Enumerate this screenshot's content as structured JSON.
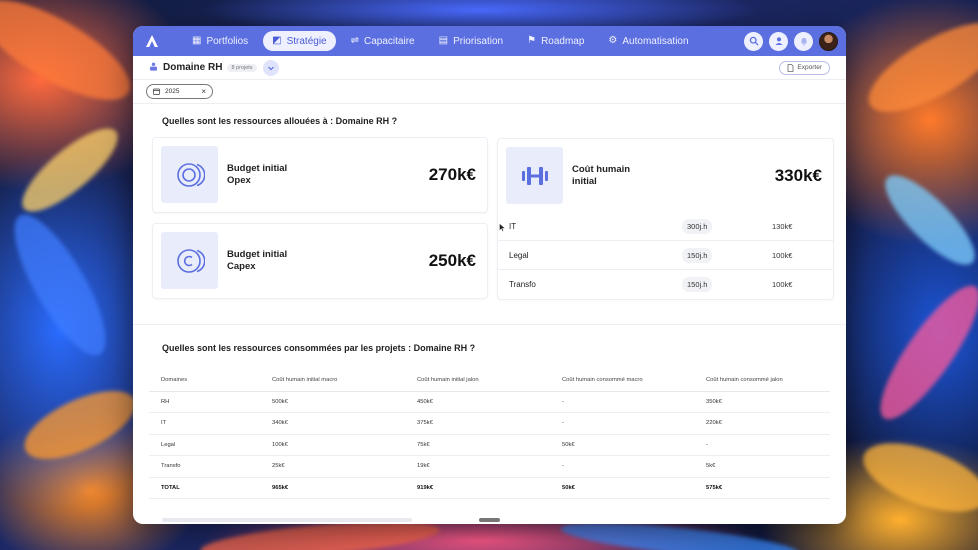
{
  "nav": {
    "items": [
      {
        "label": "Portfolios",
        "icon": "grid-icon",
        "glyph": "▦"
      },
      {
        "label": "Stratégie",
        "icon": "strategy-icon",
        "glyph": "◩"
      },
      {
        "label": "Capacitaire",
        "icon": "capacity-icon",
        "glyph": "⇌"
      },
      {
        "label": "Priorisation",
        "icon": "priority-icon",
        "glyph": "▤"
      },
      {
        "label": "Roadmap",
        "icon": "flag-icon",
        "glyph": "⚑"
      },
      {
        "label": "Automatisation",
        "icon": "robot-icon",
        "glyph": "⚙"
      }
    ],
    "active_index": 1,
    "accent": "#5b6fe0"
  },
  "subheader": {
    "title": "Domaine RH",
    "badge": "8 projets",
    "export_label": "Exporter"
  },
  "filter": {
    "year": "2025"
  },
  "section1": {
    "title": "Quelles sont les ressources allouées à : Domaine RH ?",
    "cards": [
      {
        "label_line1": "Budget initial",
        "label_line2": "Opex",
        "value": "270k€"
      },
      {
        "label_line1": "Budget initial",
        "label_line2": "Capex",
        "value": "250k€"
      },
      {
        "label_line1": "Coût humain",
        "label_line2": "initial",
        "value": "330k€"
      }
    ],
    "human_rows": [
      {
        "name": "IT",
        "effort": "300j.h",
        "cost": "130k€"
      },
      {
        "name": "Legal",
        "effort": "150j.h",
        "cost": "100k€"
      },
      {
        "name": "Transfo",
        "effort": "150j.h",
        "cost": "100k€"
      }
    ]
  },
  "section2": {
    "title": "Quelles sont les ressources consommées par les projets : Domaine RH ?",
    "headers": [
      "Domaines",
      "Coût humain initial macro",
      "Coût humain initial jalon",
      "Coût humain consommé macro",
      "Coût humain consommé jalon"
    ],
    "rows": [
      [
        "RH",
        "500k€",
        "450k€",
        "-",
        "350k€"
      ],
      [
        "IT",
        "340k€",
        "375k€",
        "-",
        "220k€"
      ],
      [
        "Legal",
        "100k€",
        "75k€",
        "50k€",
        "-"
      ],
      [
        "Transfo",
        "25k€",
        "19k€",
        "-",
        "5k€"
      ]
    ],
    "total": [
      "TOTAL",
      "965k€",
      "919k€",
      "50k€",
      "575k€"
    ]
  }
}
